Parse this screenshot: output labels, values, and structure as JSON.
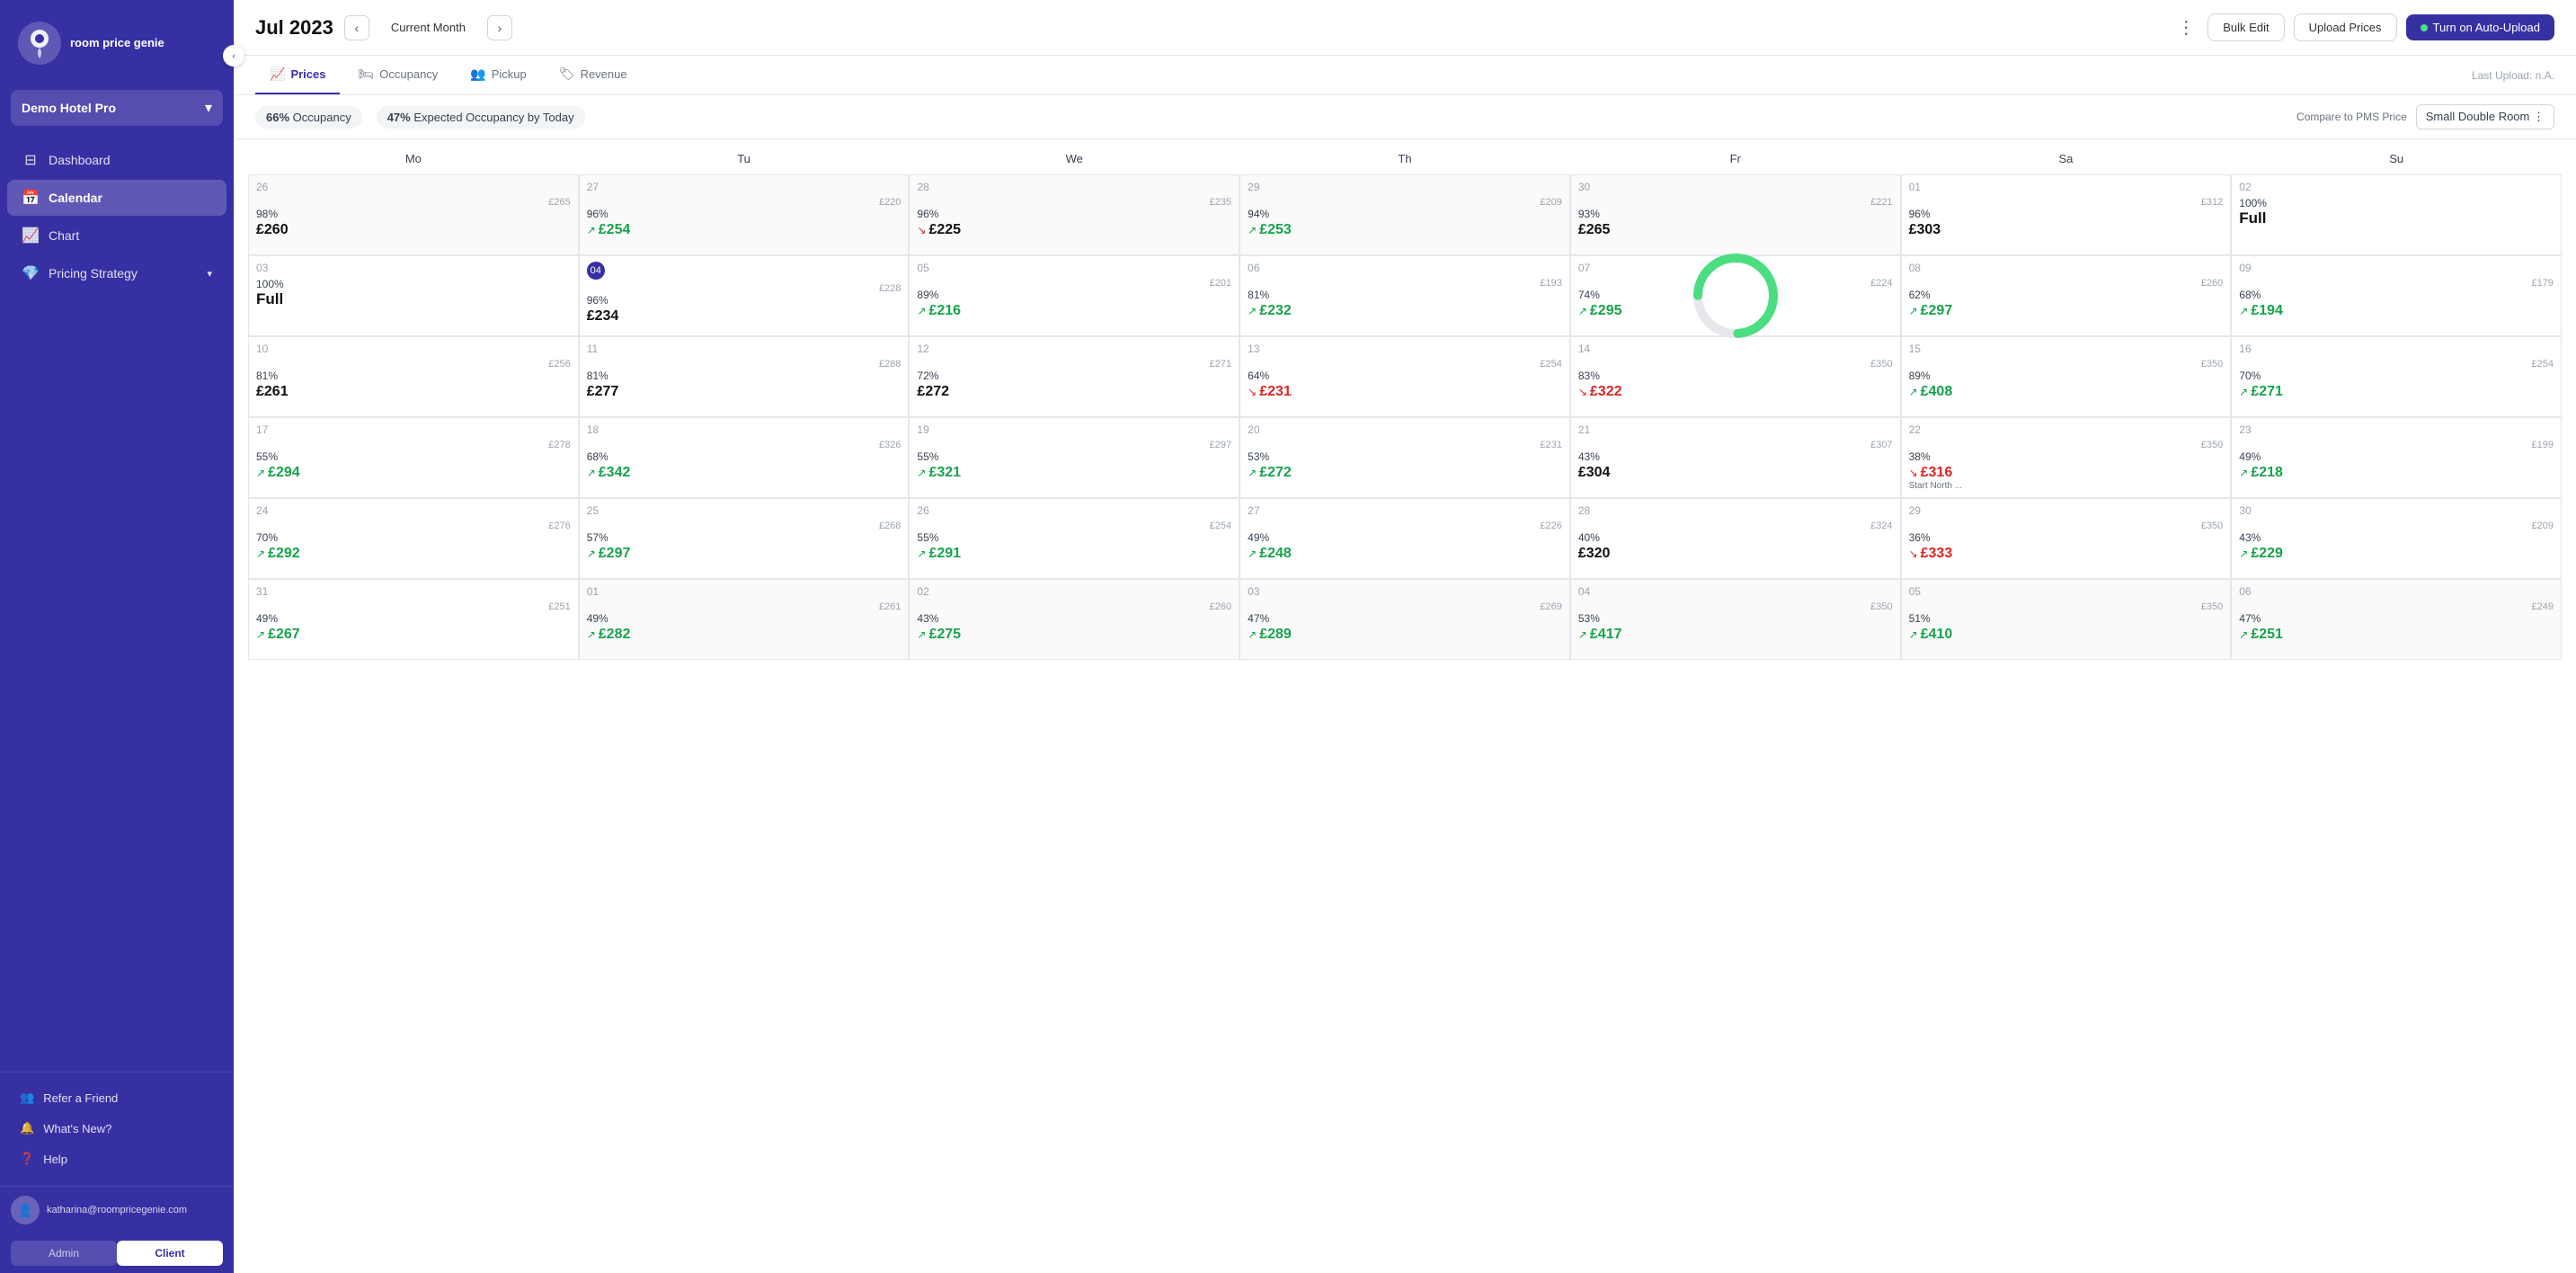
{
  "sidebar": {
    "logo_text": "room\nprice\ngenie",
    "hotel_name": "Demo Hotel Pro",
    "nav_items": [
      {
        "id": "dashboard",
        "label": "Dashboard",
        "icon": "⊟",
        "active": false
      },
      {
        "id": "calendar",
        "label": "Calendar",
        "icon": "📅",
        "active": true
      },
      {
        "id": "chart",
        "label": "Chart",
        "icon": "📈",
        "active": false
      },
      {
        "id": "pricing-strategy",
        "label": "Pricing Strategy",
        "icon": "💎",
        "active": false,
        "has_chevron": true
      }
    ],
    "bottom_items": [
      {
        "id": "refer",
        "label": "Refer a Friend",
        "icon": "👥"
      },
      {
        "id": "whats-new",
        "label": "What's New?",
        "icon": "🔔"
      },
      {
        "id": "help",
        "label": "Help",
        "icon": "❓"
      }
    ],
    "user_email": "katharina@roompricegenie.com",
    "tab_admin": "Admin",
    "tab_client": "Client"
  },
  "header": {
    "title": "Jul 2023",
    "current_month_label": "Current Month",
    "bulk_edit_label": "Bulk Edit",
    "upload_prices_label": "Upload Prices",
    "auto_upload_label": "Turn on Auto-Upload",
    "three_dot_label": "⋮"
  },
  "tabs": [
    {
      "id": "prices",
      "label": "Prices",
      "icon": "📈",
      "active": true
    },
    {
      "id": "occupancy",
      "label": "Occupancy",
      "icon": "🛏",
      "active": false
    },
    {
      "id": "pickup",
      "label": "Pickup",
      "icon": "👥",
      "active": false
    },
    {
      "id": "revenue",
      "label": "Revenue",
      "icon": "🏷",
      "active": false
    }
  ],
  "upload_info": "Last Upload: n.A.",
  "occupancy": {
    "pct": "66%",
    "label": "Occupancy",
    "expected_pct": "47%",
    "expected_label": "Expected Occupancy by Today"
  },
  "compare_label": "Compare to PMS Price",
  "room_selector": "Small Double Room",
  "day_headers": [
    "Mo",
    "Tu",
    "We",
    "Th",
    "Fr",
    "Sa",
    "Su"
  ],
  "calendar": {
    "rows": [
      {
        "cells": [
          {
            "day": "26",
            "other": true,
            "occ": "98%",
            "pms": "£265",
            "price": "£260",
            "trend": "none",
            "color": "normal"
          },
          {
            "day": "27",
            "other": true,
            "occ": "96%",
            "pms": "£220",
            "price": "£254",
            "trend": "up",
            "color": "green"
          },
          {
            "day": "28",
            "other": true,
            "occ": "96%",
            "pms": "£235",
            "price": "£225",
            "trend": "down",
            "color": "normal"
          },
          {
            "day": "29",
            "other": true,
            "occ": "94%",
            "pms": "£209",
            "price": "£253",
            "trend": "up",
            "color": "green"
          },
          {
            "day": "30",
            "other": true,
            "occ": "93%",
            "pms": "£221",
            "price": "£265",
            "trend": "none",
            "color": "normal",
            "donut": true,
            "donut_pct": 74
          },
          {
            "day": "01",
            "other": false,
            "occ": "96%",
            "pms": "£312",
            "price": "£303",
            "trend": "none",
            "color": "normal"
          },
          {
            "day": "02",
            "other": false,
            "occ": "100%",
            "price_text": "Full",
            "full": true
          }
        ]
      },
      {
        "cells": [
          {
            "day": "03",
            "other": false,
            "occ": "100%",
            "price_text": "Full",
            "full": true
          },
          {
            "day": "04 Today",
            "today": true,
            "occ": "96%",
            "pms": "£228",
            "price": "£234",
            "trend": "none",
            "color": "normal"
          },
          {
            "day": "05",
            "other": false,
            "occ": "89%",
            "pms": "£201",
            "price": "£216",
            "trend": "up",
            "color": "green"
          },
          {
            "day": "06",
            "other": false,
            "occ": "81%",
            "pms": "£193",
            "price": "£232",
            "trend": "up",
            "color": "green"
          },
          {
            "day": "07",
            "other": false,
            "occ": "74%",
            "pms": "£224",
            "price": "£295",
            "trend": "up",
            "color": "green",
            "donut": true,
            "donut_pct": 74
          },
          {
            "day": "08",
            "other": false,
            "occ": "62%",
            "pms": "£260",
            "price": "£297",
            "trend": "up",
            "color": "green"
          },
          {
            "day": "09",
            "other": false,
            "occ": "68%",
            "pms": "£179",
            "price": "£194",
            "trend": "up",
            "color": "green"
          }
        ]
      },
      {
        "cells": [
          {
            "day": "10",
            "other": false,
            "occ": "81%",
            "pms": "£256",
            "price": "£261",
            "trend": "none",
            "color": "normal"
          },
          {
            "day": "11",
            "other": false,
            "occ": "81%",
            "pms": "£288",
            "price": "£277",
            "trend": "none",
            "color": "normal"
          },
          {
            "day": "12",
            "other": false,
            "occ": "72%",
            "pms": "£271",
            "price": "£272",
            "trend": "none",
            "color": "normal"
          },
          {
            "day": "13",
            "other": false,
            "occ": "64%",
            "pms": "£254",
            "price": "£231",
            "trend": "down",
            "color": "red"
          },
          {
            "day": "14",
            "other": false,
            "occ": "83%",
            "pms": "£350",
            "price": "£322",
            "trend": "down",
            "color": "red"
          },
          {
            "day": "15",
            "other": false,
            "occ": "89%",
            "pms": "£350",
            "price": "£408",
            "trend": "up",
            "color": "green"
          },
          {
            "day": "16",
            "other": false,
            "occ": "70%",
            "pms": "£254",
            "price": "£271",
            "trend": "up",
            "color": "green"
          }
        ]
      },
      {
        "cells": [
          {
            "day": "17",
            "other": false,
            "occ": "55%",
            "pms": "£278",
            "price": "£294",
            "trend": "up",
            "color": "green"
          },
          {
            "day": "18",
            "other": false,
            "occ": "68%",
            "pms": "£326",
            "price": "£342",
            "trend": "up",
            "color": "green"
          },
          {
            "day": "19",
            "other": false,
            "occ": "55%",
            "pms": "£297",
            "price": "£321",
            "trend": "up",
            "color": "green"
          },
          {
            "day": "20",
            "other": false,
            "occ": "53%",
            "pms": "£231",
            "price": "£272",
            "trend": "up",
            "color": "green"
          },
          {
            "day": "21",
            "other": false,
            "occ": "43%",
            "pms": "£307",
            "price": "£304",
            "trend": "none",
            "color": "normal"
          },
          {
            "day": "22",
            "other": false,
            "event": "Start North ...",
            "occ": "38%",
            "pms": "£350",
            "price": "£316",
            "trend": "down",
            "color": "red"
          },
          {
            "day": "23",
            "other": false,
            "occ": "49%",
            "pms": "£199",
            "price": "£218",
            "trend": "up",
            "color": "green"
          }
        ]
      },
      {
        "cells": [
          {
            "day": "24",
            "other": false,
            "occ": "70%",
            "pms": "£276",
            "price": "£292",
            "trend": "up",
            "color": "green"
          },
          {
            "day": "25",
            "other": false,
            "occ": "57%",
            "pms": "£268",
            "price": "£297",
            "trend": "up",
            "color": "green"
          },
          {
            "day": "26",
            "other": false,
            "occ": "55%",
            "pms": "£254",
            "price": "£291",
            "trend": "up",
            "color": "green"
          },
          {
            "day": "27",
            "other": false,
            "occ": "49%",
            "pms": "£226",
            "price": "£248",
            "trend": "up",
            "color": "green"
          },
          {
            "day": "28",
            "other": false,
            "occ": "40%",
            "pms": "£324",
            "price": "£320",
            "trend": "none",
            "color": "normal"
          },
          {
            "day": "29",
            "other": false,
            "occ": "36%",
            "pms": "£350",
            "price": "£333",
            "trend": "down",
            "color": "red"
          },
          {
            "day": "30",
            "other": false,
            "occ": "43%",
            "pms": "£209",
            "price": "£229",
            "trend": "up",
            "color": "green"
          }
        ]
      },
      {
        "cells": [
          {
            "day": "31",
            "other": false,
            "occ": "49%",
            "pms": "£251",
            "price": "£267",
            "trend": "up",
            "color": "green"
          },
          {
            "day": "01",
            "other": true,
            "occ": "49%",
            "pms": "£261",
            "price": "£282",
            "trend": "up",
            "color": "green"
          },
          {
            "day": "02",
            "other": true,
            "occ": "43%",
            "pms": "£260",
            "price": "£275",
            "trend": "up",
            "color": "green"
          },
          {
            "day": "03",
            "other": true,
            "occ": "47%",
            "pms": "£269",
            "price": "£289",
            "trend": "up",
            "color": "green"
          },
          {
            "day": "04",
            "other": true,
            "occ": "53%",
            "pms": "£350",
            "price": "£417",
            "trend": "up",
            "color": "green"
          },
          {
            "day": "05",
            "other": true,
            "occ": "51%",
            "pms": "£350",
            "price": "£410",
            "trend": "up",
            "color": "green"
          },
          {
            "day": "06",
            "other": true,
            "occ": "47%",
            "pms": "£249",
            "price": "£251",
            "trend": "up",
            "color": "green"
          }
        ]
      }
    ]
  }
}
